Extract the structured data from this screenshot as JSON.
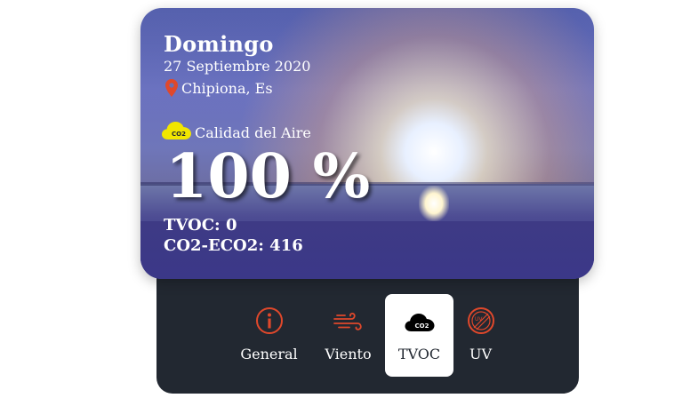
{
  "weather": {
    "day": "Domingo",
    "date": "27 Septiembre 2020",
    "location": "Chipiona, Es",
    "air_quality_label": "Calidad del Aire",
    "air_quality_value": "100 %",
    "tvoc_line": "TVOC: 0",
    "co2_line": "CO2-ECO2: 416",
    "co2_badge": "CO2"
  },
  "tabs": [
    {
      "label": "General",
      "icon": "info-icon",
      "active": false
    },
    {
      "label": "Viento",
      "icon": "wind-icon",
      "active": false
    },
    {
      "label": "TVOC",
      "icon": "co2-cloud-icon",
      "active": true
    },
    {
      "label": "UV",
      "icon": "uv-icon",
      "active": false
    }
  ],
  "colors": {
    "panel": "#222831",
    "accent": "#e0482b",
    "badge_yellow": "#f2e600"
  }
}
